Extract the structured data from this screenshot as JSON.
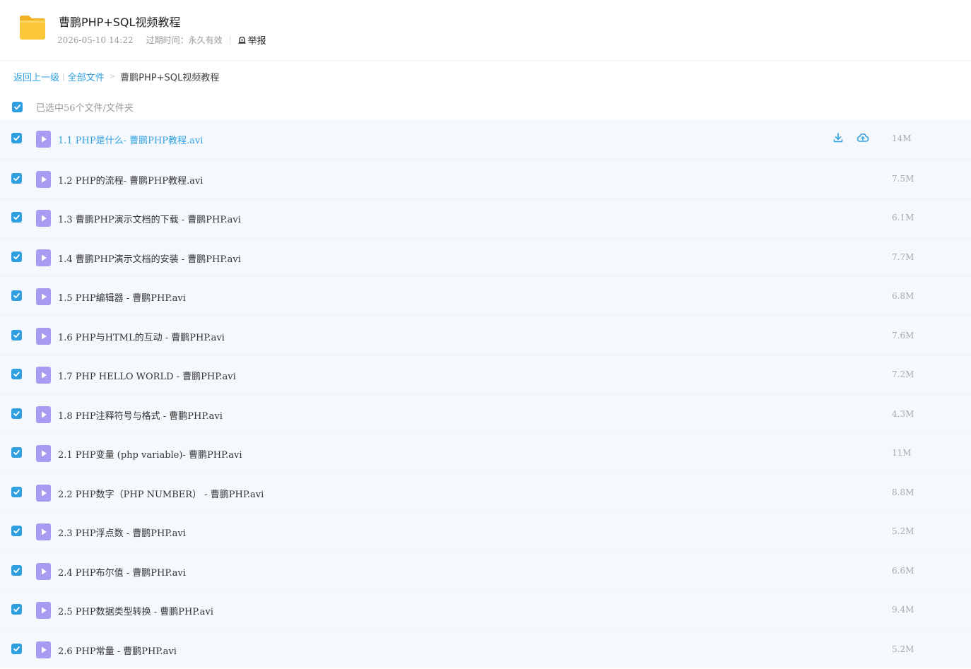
{
  "header": {
    "title": "曹鹏PHP+SQL视频教程",
    "date": "2026-05-10 14:22",
    "expire_label": "过期时间：永久有效",
    "report_label": "举报"
  },
  "breadcrumb": {
    "back": "返回上一级",
    "separator": "|",
    "all_files": "全部文件",
    "arrow": ">",
    "current": "曹鹏PHP+SQL视频教程"
  },
  "selection": {
    "summary": "已选中56个文件/文件夹"
  },
  "colors": {
    "accent": "#2f9fe0",
    "folder": "#f9c738",
    "video_icon": "#a89cf2",
    "row_bg": "#f5f9fd"
  },
  "files": [
    {
      "name": "1.1 PHP是什么- 曹鹏PHP教程.avi",
      "size": "14M",
      "highlighted": true
    },
    {
      "name": "1.2 PHP的流程- 曹鹏PHP教程.avi",
      "size": "7.5M"
    },
    {
      "name": "1.3 曹鹏PHP演示文档的下载 - 曹鹏PHP.avi",
      "size": "6.1M"
    },
    {
      "name": "1.4 曹鹏PHP演示文档的安装 - 曹鹏PHP.avi",
      "size": "7.7M"
    },
    {
      "name": "1.5 PHP编辑器 - 曹鹏PHP.avi",
      "size": "6.8M"
    },
    {
      "name": "1.6 PHP与HTML的互动 - 曹鹏PHP.avi",
      "size": "7.6M"
    },
    {
      "name": "1.7 PHP HELLO WORLD - 曹鹏PHP.avi",
      "size": "7.2M"
    },
    {
      "name": "1.8 PHP注释符号与格式 - 曹鹏PHP.avi",
      "size": "4.3M"
    },
    {
      "name": "2.1 PHP变量 (php variable)- 曹鹏PHP.avi",
      "size": "11M"
    },
    {
      "name": "2.2 PHP数字（PHP NUMBER） - 曹鹏PHP.avi",
      "size": "8.8M"
    },
    {
      "name": "2.3 PHP浮点数 - 曹鹏PHP.avi",
      "size": "5.2M"
    },
    {
      "name": "2.4 PHP布尔值 - 曹鹏PHP.avi",
      "size": "6.6M"
    },
    {
      "name": "2.5 PHP数据类型转换 - 曹鹏PHP.avi",
      "size": "9.4M"
    },
    {
      "name": "2.6 PHP常量 - 曹鹏PHP.avi",
      "size": "5.2M"
    }
  ]
}
